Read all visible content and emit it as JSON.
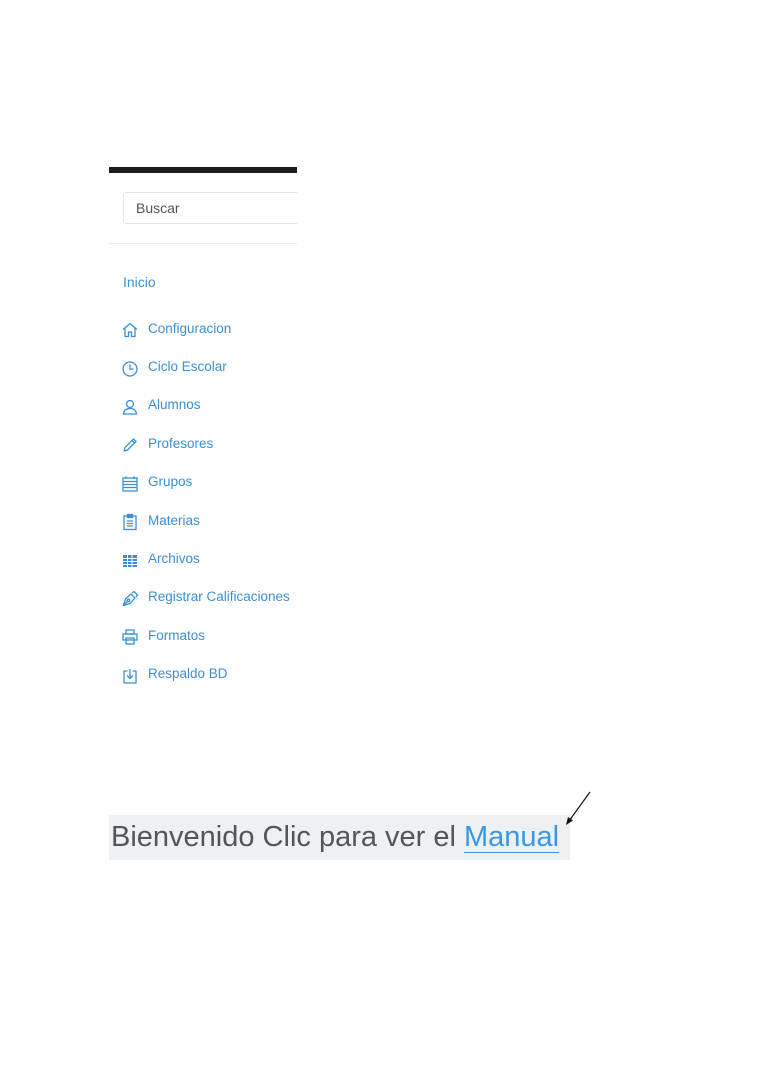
{
  "search": {
    "placeholder": "Buscar"
  },
  "nav": {
    "home_label": "Inicio",
    "items": [
      {
        "label": "Configuracion",
        "icon": "home-icon"
      },
      {
        "label": "Ciclo Escolar",
        "icon": "clock-icon"
      },
      {
        "label": "Alumnos",
        "icon": "user-icon"
      },
      {
        "label": "Profesores",
        "icon": "pencil-icon"
      },
      {
        "label": "Grupos",
        "icon": "calendar-icon"
      },
      {
        "label": "Materias",
        "icon": "clipboard-icon"
      },
      {
        "label": "Archivos",
        "icon": "table-icon"
      },
      {
        "label": "Registrar Calificaciones",
        "icon": "pen-nib-icon"
      },
      {
        "label": "Formatos",
        "icon": "printer-icon"
      },
      {
        "label": "Respaldo BD",
        "icon": "download-icon"
      }
    ]
  },
  "welcome": {
    "text": "Bienvenido Clic para ver el",
    "link_label": "Manual"
  },
  "colors": {
    "accent": "#3a8fd6",
    "link": "#3a97e6",
    "text": "#555555",
    "welcome_bg": "#eef1f4",
    "topbar": "#1c1c1c"
  }
}
